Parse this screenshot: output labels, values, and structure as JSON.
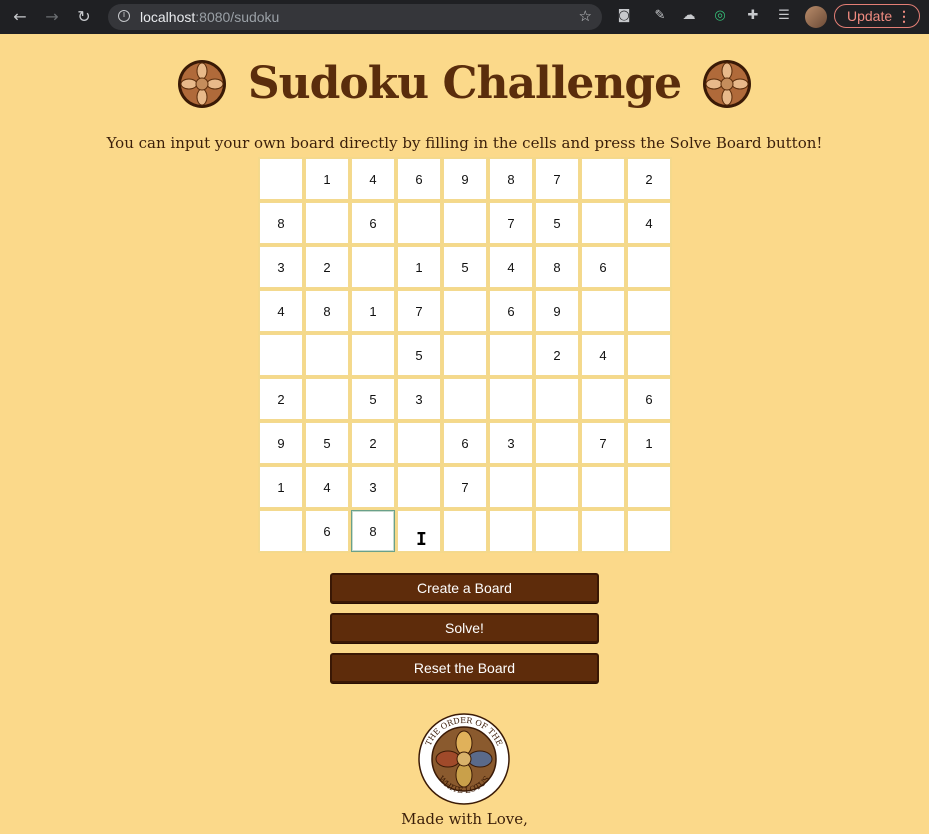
{
  "browser": {
    "url_host": "localhost",
    "url_rest": ":8080/sudoku",
    "update_label": "Update",
    "update_more": "⋮"
  },
  "page": {
    "title": "Sudoku Challenge",
    "instructions": "You can input your own board directly by filling in the cells and press the Solve Board button!",
    "made_with": "Made with Love,",
    "logo_text_top": "THE ORDER OF THE",
    "logo_text_bottom": "WHITE LOTUS"
  },
  "board": [
    [
      "",
      "1",
      "4",
      "6",
      "9",
      "8",
      "7",
      "",
      "2"
    ],
    [
      "8",
      "",
      "6",
      "",
      "",
      "7",
      "5",
      "",
      "4"
    ],
    [
      "3",
      "2",
      "",
      "1",
      "5",
      "4",
      "8",
      "6",
      ""
    ],
    [
      "4",
      "8",
      "1",
      "7",
      "",
      "6",
      "9",
      "",
      ""
    ],
    [
      "",
      "",
      "",
      "5",
      "",
      "",
      "2",
      "4",
      ""
    ],
    [
      "2",
      "",
      "5",
      "3",
      "",
      "",
      "",
      "",
      "6"
    ],
    [
      "9",
      "5",
      "2",
      "",
      "6",
      "3",
      "",
      "7",
      "1"
    ],
    [
      "1",
      "4",
      "3",
      "",
      "7",
      "",
      "",
      "",
      ""
    ],
    [
      "",
      "6",
      "8",
      "",
      "",
      "",
      "",
      "",
      ""
    ]
  ],
  "active_cell": [
    8,
    2
  ],
  "buttons": {
    "create": "Create a Board",
    "solve": "Solve!",
    "reset": "Reset the Board"
  },
  "colors": {
    "background": "#fbd98a",
    "title": "#5a2d0c",
    "button": "#5e2c0b"
  }
}
